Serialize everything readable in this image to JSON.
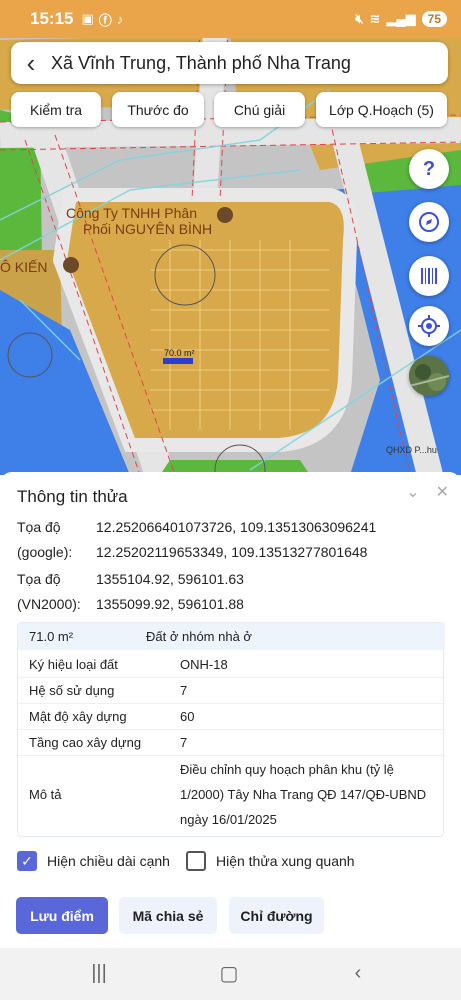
{
  "status_bar": {
    "time": "15:15",
    "battery": "75"
  },
  "search": {
    "title": "Xã Vĩnh Trung, Thành phố Nha Trang"
  },
  "toolbar": {
    "chips": [
      "Kiểm tra",
      "Thước đo",
      "Chú giải",
      "Lớp Q.Hoạch (5)"
    ]
  },
  "map": {
    "company_label_line1": "Công Ty TNHH Phân",
    "company_label_line2": "Phối NGUYÊN BÌNH",
    "left_label": "Ô KIẾN",
    "area_label": "70.0 m²",
    "credit": "QHXD P...hu",
    "help_symbol": "?"
  },
  "parcel": {
    "title": "Thông tin thửa",
    "coords": [
      {
        "label": "Tọa độ",
        "value": "12.252066401073726, 109.13513063096241"
      },
      {
        "label": "(google):",
        "value": "12.25202119653349, 109.13513277801648"
      },
      {
        "label": "Tọa độ",
        "value": "1355104.92, 596101.63"
      },
      {
        "label": "(VN2000):",
        "value": "1355099.92, 596101.88"
      }
    ],
    "area": "71.0 m²",
    "land_type": "Đất ở nhóm nhà ở",
    "attributes": [
      {
        "key": "Ký hiệu loại đất",
        "value": "ONH-18"
      },
      {
        "key": "Hệ số sử dụng",
        "value": "7"
      },
      {
        "key": "Mật độ xây dựng",
        "value": "60"
      },
      {
        "key": "Tầng cao xây dựng",
        "value": "7"
      },
      {
        "key": "Mô tả",
        "value": "Điều chỉnh quy hoạch phân khu (tỷ lệ 1/2000) Tây Nha Trang QĐ 147/QĐ-UBND ngày 16/01/2025"
      }
    ],
    "checkbox_edge": {
      "label": "Hiện chiều dài cạnh",
      "checked": true
    },
    "checkbox_around": {
      "label": "Hiện thửa xung quanh",
      "checked": false
    }
  },
  "actions": {
    "save": "Lưu điểm",
    "share": "Mã chia sẻ",
    "directions": "Chỉ đường"
  },
  "colors": {
    "accent": "#5a67d8",
    "land": "#d8a94a",
    "water": "#3f7fe8",
    "green": "#5bb83d"
  }
}
